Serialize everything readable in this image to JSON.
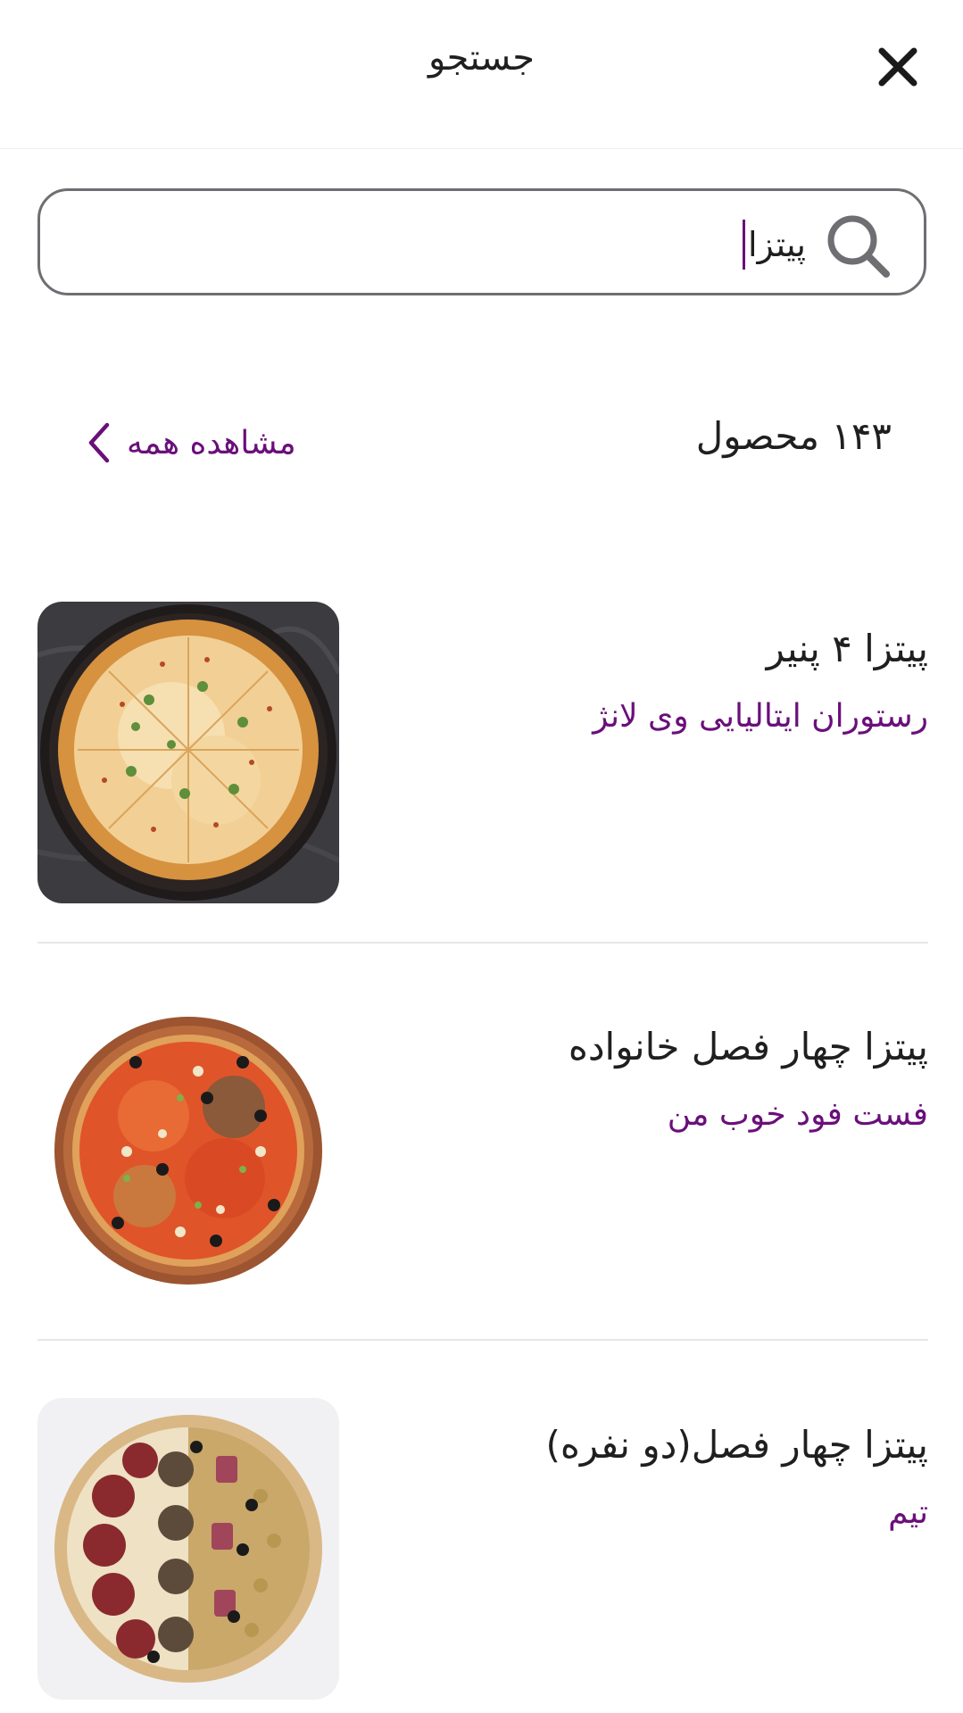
{
  "header": {
    "title": "جستجو"
  },
  "search": {
    "value": "پیتزا",
    "placeholder": ""
  },
  "results": {
    "count_label": "۱۴۳ محصول",
    "view_all_label": "مشاهده همه"
  },
  "products": [
    {
      "name": "پیتزا ۴ پنیر",
      "store": "رستوران ایتالیایی وی لانژ"
    },
    {
      "name": "پیتزا چهار فصل خانواده",
      "store": "فست فود خوب من"
    },
    {
      "name": "پیتزا چهار فصل(دو نفره)",
      "store": "تیم"
    }
  ],
  "colors": {
    "accent": "#6a0f7a",
    "text": "#1f1f1f",
    "border": "#6e6e73",
    "divider": "#e6e6e6"
  },
  "icons": {
    "close": "close-icon",
    "search": "search-icon",
    "chevron": "chevron-left-icon"
  }
}
